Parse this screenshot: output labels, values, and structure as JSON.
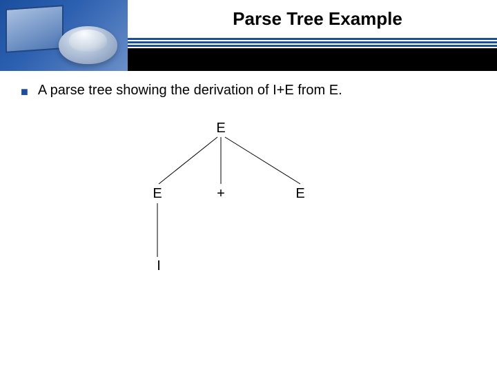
{
  "header": {
    "title": "Parse Tree Example"
  },
  "body": {
    "bullet_symbol": "■",
    "bullet_text": "A parse tree showing the derivation of I+E from E."
  },
  "tree": {
    "root": "E",
    "child_left": "E",
    "child_mid": "+",
    "child_right": "E",
    "leaf": "I"
  }
}
